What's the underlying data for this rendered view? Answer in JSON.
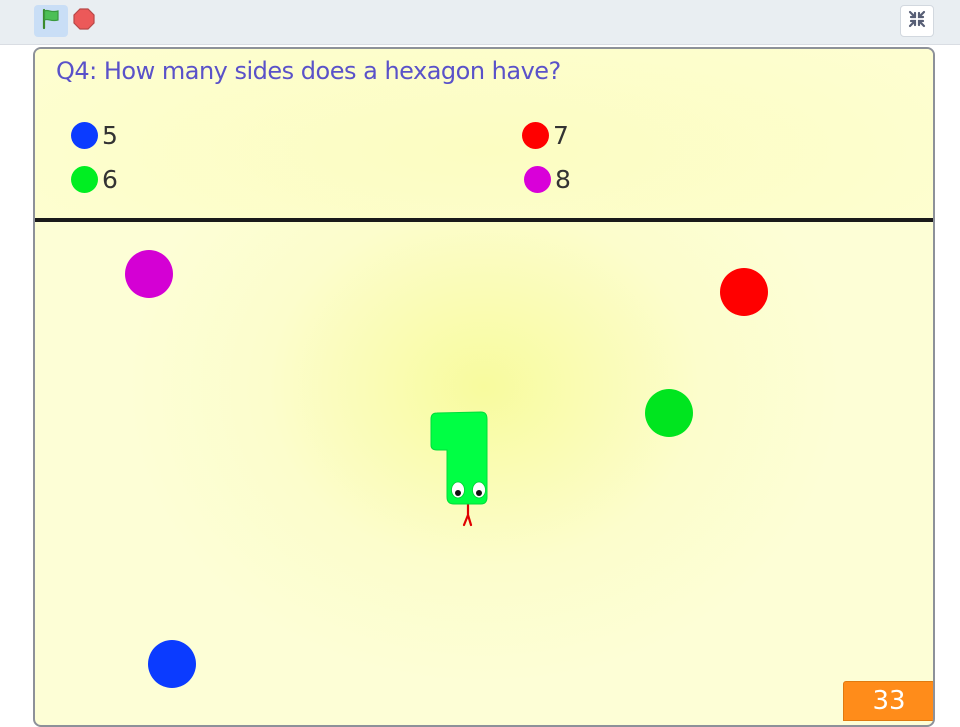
{
  "toolbar": {
    "green_flag_icon": "green-flag-icon",
    "stop_icon": "stop-sign-icon",
    "fullscreen_icon": "exit-fullscreen-icon"
  },
  "question": {
    "text": "Q4: How many sides does a hexagon have?"
  },
  "answers": [
    {
      "color": "#0b3bff",
      "label": "5"
    },
    {
      "color": "#00ee22",
      "label": "6"
    },
    {
      "color": "#ff0000",
      "label": "7"
    },
    {
      "color": "#d900d9",
      "label": "8"
    }
  ],
  "balls": [
    {
      "name": "magenta-ball",
      "color": "#d400d4"
    },
    {
      "name": "red-ball",
      "color": "#ff0000"
    },
    {
      "name": "green-ball",
      "color": "#00e51f"
    },
    {
      "name": "blue-ball",
      "color": "#0b3bff"
    }
  ],
  "snake": {
    "body_color": "#00ff44",
    "tongue_color": "#e00000"
  },
  "timer": {
    "value": "33",
    "color": "#ff8c1a"
  }
}
